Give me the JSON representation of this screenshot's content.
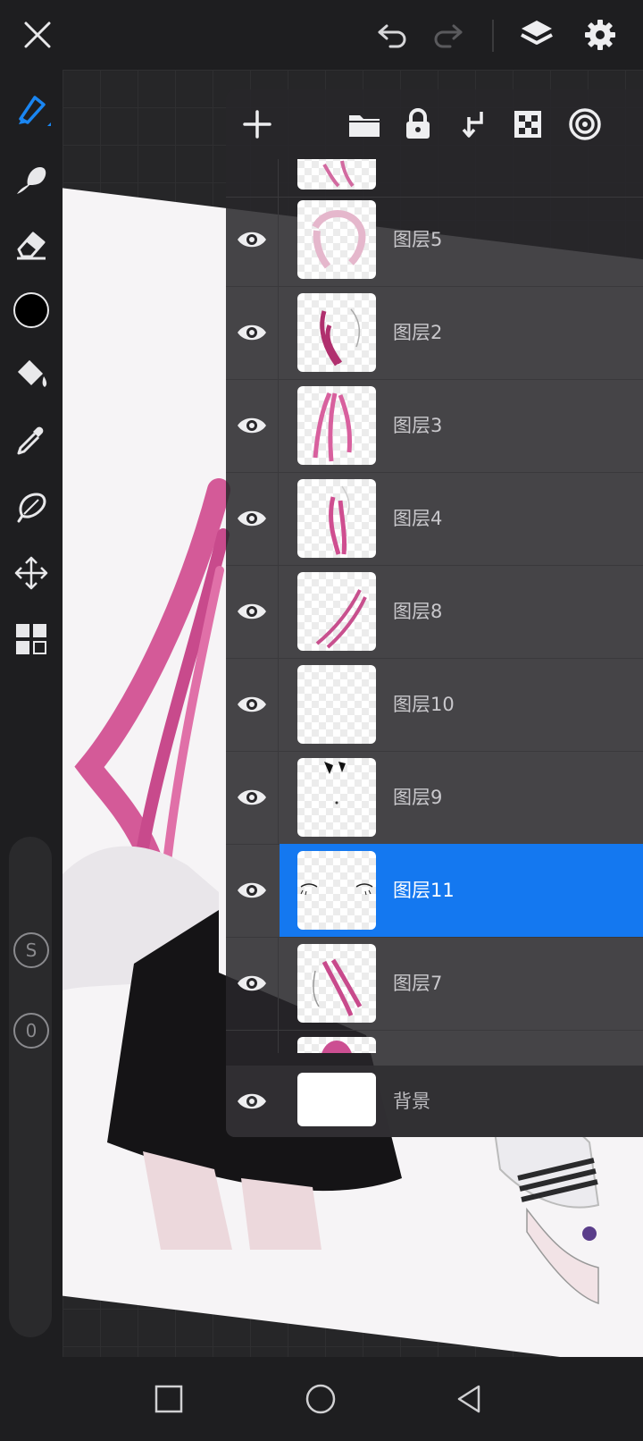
{
  "topbar": {
    "icons": [
      "close-icon",
      "undo-icon",
      "redo-icon",
      "layers-icon",
      "settings-icon"
    ]
  },
  "left_toolbar": {
    "tools": [
      "brush-icon",
      "smudge-icon",
      "eraser-icon",
      "color-swatch",
      "fill-bucket-icon",
      "eyedropper-icon",
      "lasso-icon",
      "transform-icon",
      "grid-icon"
    ],
    "current_color": "#000000",
    "size_button_label": "S",
    "opacity_button_label": "0"
  },
  "layer_panel": {
    "toolbar_icons": [
      "add-layer-icon",
      "folder-icon",
      "lock-icon",
      "merge-down-icon",
      "alpha-lock-icon",
      "clipping-icon"
    ],
    "layers": [
      {
        "name": "图层5",
        "selected": false
      },
      {
        "name": "图层2",
        "selected": false
      },
      {
        "name": "图层3",
        "selected": false
      },
      {
        "name": "图层4",
        "selected": false
      },
      {
        "name": "图层8",
        "selected": false
      },
      {
        "name": "图层10",
        "selected": false
      },
      {
        "name": "图层9",
        "selected": false
      },
      {
        "name": "图层11",
        "selected": true
      },
      {
        "name": "图层7",
        "selected": false
      }
    ],
    "background_layer": {
      "name": "背景"
    },
    "selection_color": "#1478f0"
  },
  "navbar": {
    "icons": [
      "recent-apps-icon",
      "home-icon",
      "back-icon"
    ]
  }
}
